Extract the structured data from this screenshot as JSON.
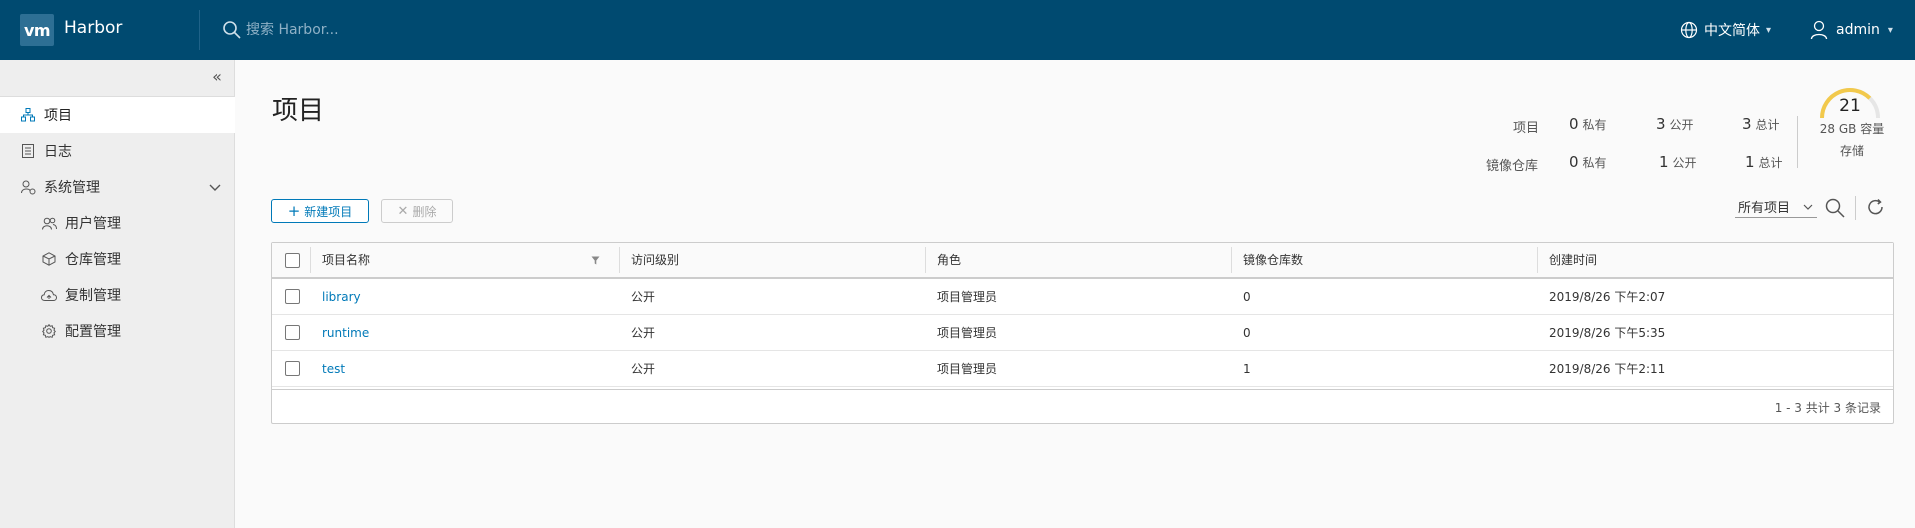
{
  "header": {
    "logo_text": "vm",
    "brand": "Harbor",
    "search_placeholder": "搜索 Harbor...",
    "language": "中文简体",
    "user": "admin",
    "bg_color": "#004a70"
  },
  "sidebar": {
    "items": [
      {
        "label": "项目",
        "icon": "projects-icon",
        "active": true
      },
      {
        "label": "日志",
        "icon": "logs-icon"
      },
      {
        "label": "系统管理",
        "icon": "admin-icon",
        "expanded": true
      },
      {
        "label": "用户管理",
        "icon": "users-icon"
      },
      {
        "label": "仓库管理",
        "icon": "registry-icon"
      },
      {
        "label": "复制管理",
        "icon": "replication-icon"
      },
      {
        "label": "配置管理",
        "icon": "settings-icon"
      }
    ]
  },
  "main": {
    "title": "项目",
    "stats": {
      "projects_label": "项目",
      "repos_label": "镜像仓库",
      "private_label": "私有",
      "public_label": "公开",
      "total_label": "总计",
      "projects": {
        "private": "0",
        "public": "3",
        "total": "3"
      },
      "repos": {
        "private": "0",
        "public": "1",
        "total": "1"
      }
    },
    "storage": {
      "value": "21",
      "capacity_text": "28 GB 容量",
      "label": "存储",
      "used_fraction": 0.75
    },
    "toolbar": {
      "new_label": "新建项目",
      "delete_label": "删除",
      "filter_value": "所有项目"
    },
    "table": {
      "columns": [
        "项目名称",
        "访问级别",
        "角色",
        "镜像仓库数",
        "创建时间"
      ],
      "rows": [
        {
          "name": "library",
          "access": "公开",
          "role": "项目管理员",
          "repos": "0",
          "created": "2019/8/26 下午2:07"
        },
        {
          "name": "runtime",
          "access": "公开",
          "role": "项目管理员",
          "repos": "0",
          "created": "2019/8/26 下午5:35"
        },
        {
          "name": "test",
          "access": "公开",
          "role": "项目管理员",
          "repos": "1",
          "created": "2019/8/26 下午2:11"
        }
      ],
      "footer": "1 - 3 共计 3 条记录"
    }
  }
}
